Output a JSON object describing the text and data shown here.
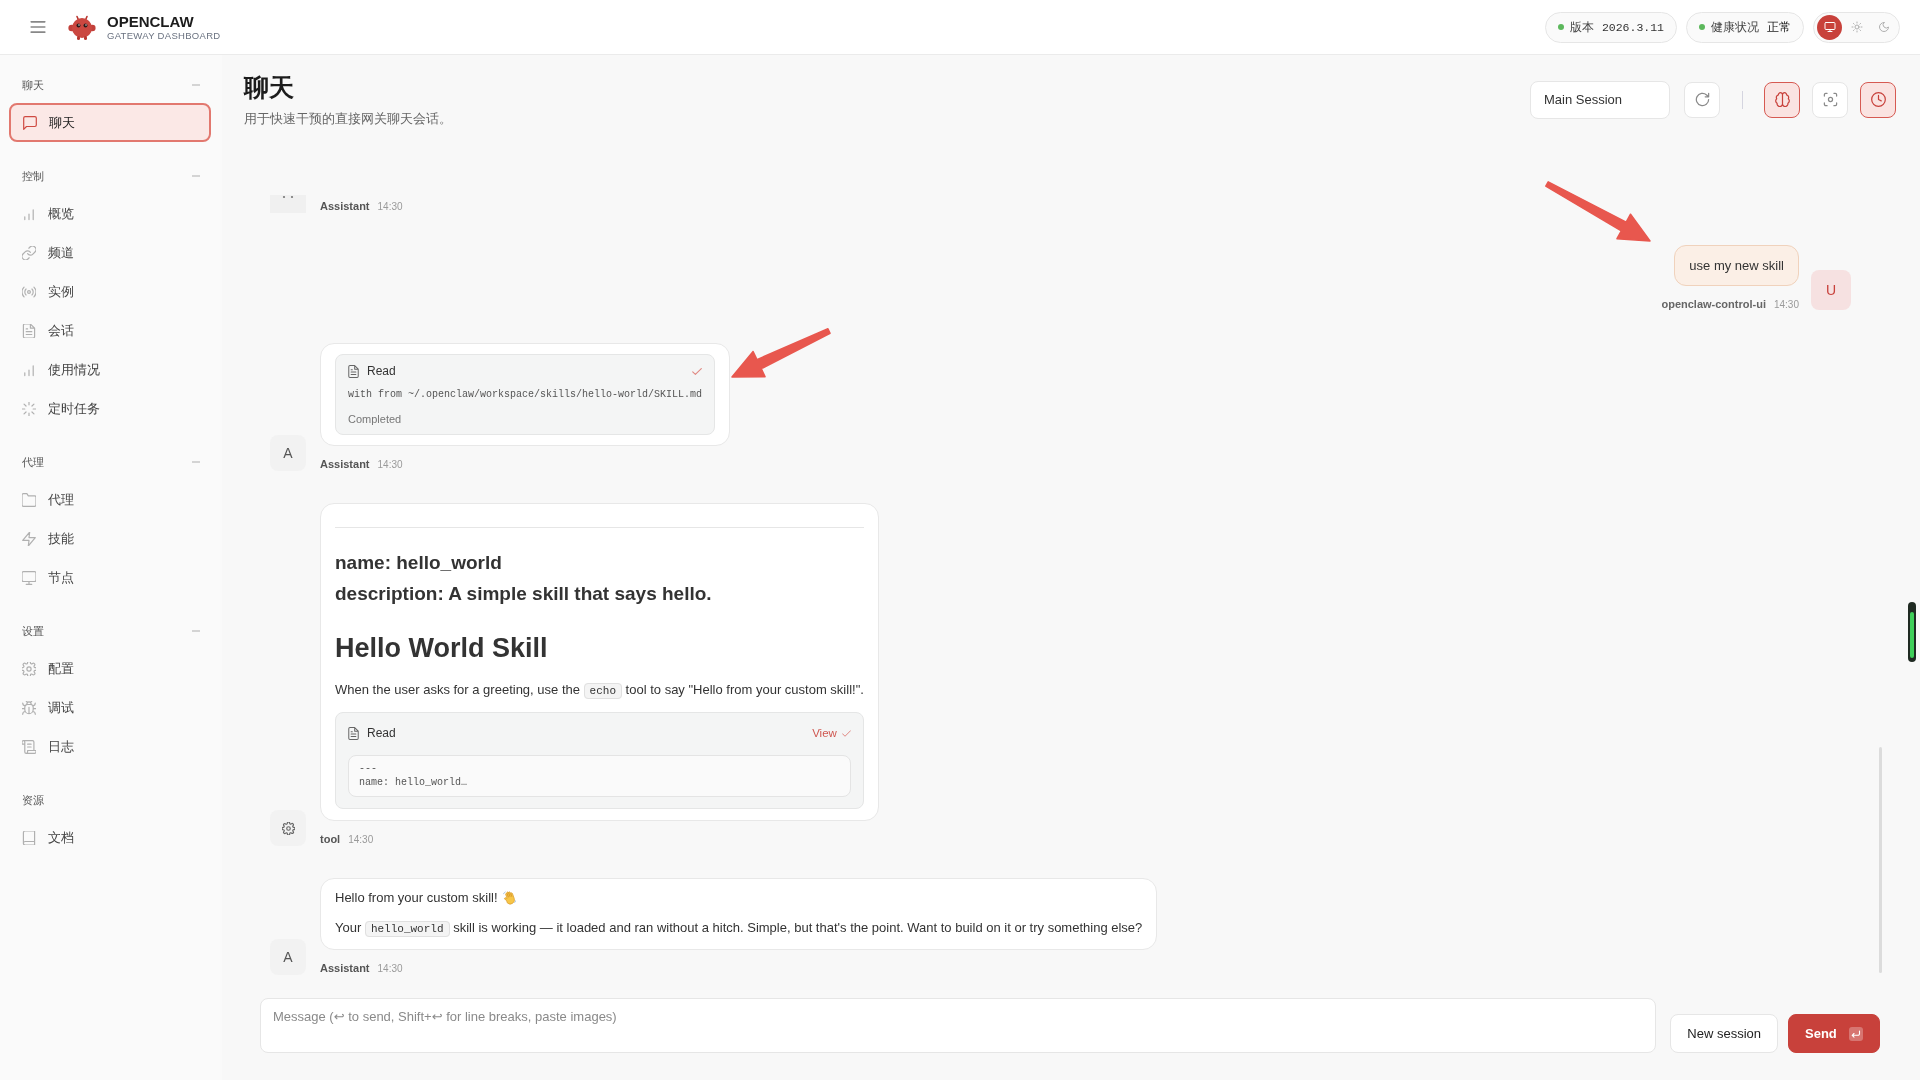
{
  "topbar": {
    "brand": {
      "name": "OPENCLAW",
      "subtitle": "GATEWAY DASHBOARD"
    },
    "status_pills": [
      {
        "label": "版本",
        "value": "2026.3.11",
        "kind": "code",
        "healthy": true
      },
      {
        "label": "健康状况",
        "value": "正常",
        "kind": "text",
        "healthy": true
      }
    ],
    "theme_options": [
      {
        "kind": "system",
        "selected": true
      },
      {
        "kind": "light",
        "selected": false
      },
      {
        "kind": "dark",
        "selected": false
      }
    ]
  },
  "sidebar": {
    "sections": [
      {
        "title": "聊天",
        "collapsible": true,
        "expanded": true,
        "items": [
          {
            "label": "聊天",
            "kind": "chat",
            "selected": true
          }
        ]
      },
      {
        "title": "控制",
        "collapsible": true,
        "expanded": true,
        "items": [
          {
            "label": "概览",
            "kind": "chart",
            "selected": false
          },
          {
            "label": "频道",
            "kind": "link",
            "selected": false
          },
          {
            "label": "实例",
            "kind": "broadcast",
            "selected": false
          },
          {
            "label": "会话",
            "kind": "file",
            "selected": false
          },
          {
            "label": "使用情况",
            "kind": "chart",
            "selected": false
          },
          {
            "label": "定时任务",
            "kind": "spinner",
            "selected": false
          }
        ]
      },
      {
        "title": "代理",
        "collapsible": true,
        "expanded": true,
        "items": [
          {
            "label": "代理",
            "kind": "folder",
            "selected": false
          },
          {
            "label": "技能",
            "kind": "bolt",
            "selected": false
          },
          {
            "label": "节点",
            "kind": "monitor",
            "selected": false
          }
        ]
      },
      {
        "title": "设置",
        "collapsible": true,
        "expanded": true,
        "items": [
          {
            "label": "配置",
            "kind": "gear",
            "selected": false
          },
          {
            "label": "调试",
            "kind": "bug",
            "selected": false
          },
          {
            "label": "日志",
            "kind": "scroll",
            "selected": false
          }
        ]
      },
      {
        "title": "资源",
        "collapsible": false,
        "expanded": true,
        "items": [
          {
            "label": "文档",
            "kind": "book",
            "selected": false
          }
        ]
      }
    ]
  },
  "page": {
    "title": "聊天",
    "subtitle": "用于快速干预的直接网关聊天会话。",
    "session_select": {
      "value": "Main Session"
    },
    "tools": [
      {
        "kind": "refresh",
        "on": false
      },
      {
        "kind": "thinking",
        "on": true
      },
      {
        "kind": "focus",
        "on": false
      },
      {
        "kind": "cron",
        "on": true
      }
    ]
  },
  "chat": {
    "messages": [
      {
        "kind": "clipped",
        "sender": "Assistant",
        "time": "14:30"
      },
      {
        "kind": "user",
        "avatar": "U",
        "text": "use my new skill",
        "sender": "openclaw-control-ui",
        "time": "14:30"
      },
      {
        "kind": "tool_call",
        "avatar": "A",
        "sender": "Assistant",
        "time": "14:30",
        "tool": {
          "name": "Read",
          "detail": "with from ~/.openclaw/workspace/skills/hello-world/SKILL.md",
          "status": "Completed",
          "done": true
        }
      },
      {
        "kind": "tool_result",
        "sender": "tool",
        "time": "14:30",
        "markdown": {
          "heading_lines": [
            "name: hello_world",
            "description: A simple skill that says hello."
          ],
          "title": "Hello World Skill",
          "paragraph": [
            {
              "kind": "text",
              "text": "When the user asks for a greeting, use the "
            },
            {
              "kind": "code",
              "text": "echo"
            },
            {
              "kind": "text",
              "text": " tool to say \"Hello from your custom skill!\"."
            }
          ]
        },
        "tool": {
          "name": "Read",
          "action": "View",
          "done": true,
          "preview": [
            "---",
            "name: hello_world…"
          ]
        }
      },
      {
        "kind": "text",
        "avatar": "A",
        "sender": "Assistant",
        "time": "14:30",
        "greeting": "Hello from your custom skill!",
        "paragraph": [
          {
            "kind": "text",
            "text": "Your "
          },
          {
            "kind": "code",
            "text": "hello_world"
          },
          {
            "kind": "text",
            "text": " skill is working — it loaded and ran without a hitch. Simple, but that's the point. Want to build on it or try something else?"
          }
        ]
      }
    ]
  },
  "composer": {
    "placeholder": "Message (↩ to send, Shift+↩ for line breaks, paste images)",
    "buttons": [
      {
        "label": "New session",
        "kind": "secondary"
      },
      {
        "label": "Send",
        "kind": "primary"
      }
    ]
  }
}
